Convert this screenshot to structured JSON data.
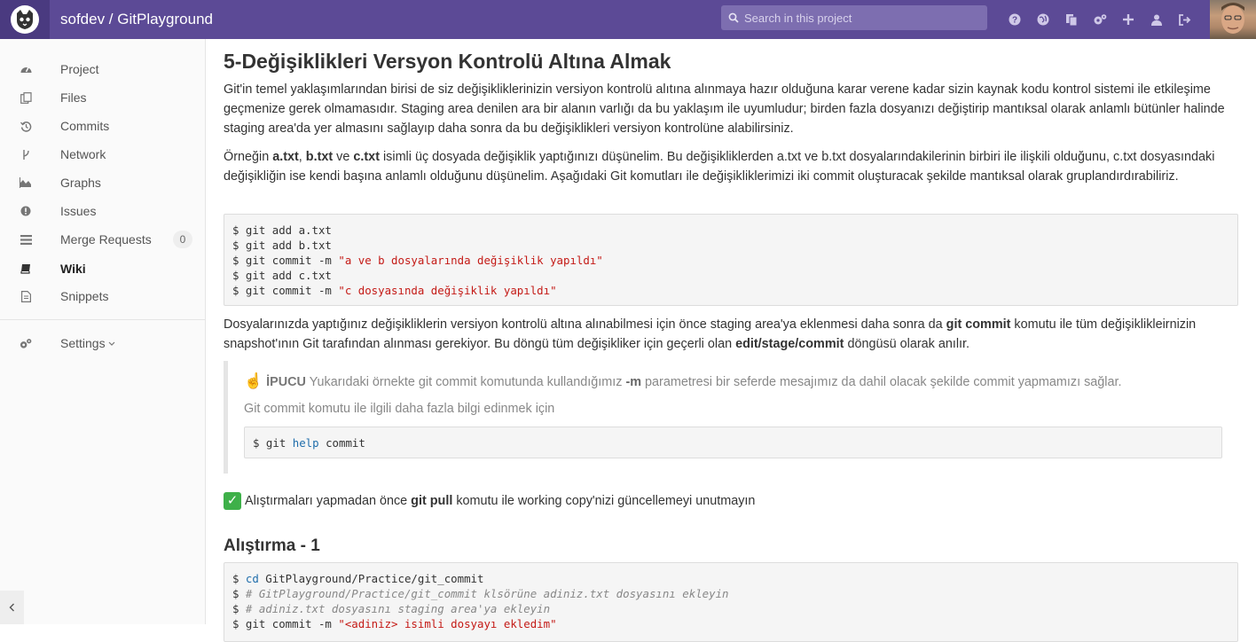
{
  "header": {
    "title": "sofdev / GitPlayground",
    "search_placeholder": "Search in this project",
    "icons": [
      "help-icon",
      "globe-icon",
      "copy-icon",
      "admin-icon",
      "plus-icon",
      "user-icon",
      "signout-icon"
    ]
  },
  "sidebar": {
    "items": [
      {
        "label": "Project",
        "icon": "dashboard-icon"
      },
      {
        "label": "Files",
        "icon": "files-icon"
      },
      {
        "label": "Commits",
        "icon": "history-icon"
      },
      {
        "label": "Network",
        "icon": "branch-icon"
      },
      {
        "label": "Graphs",
        "icon": "area-chart-icon"
      },
      {
        "label": "Issues",
        "icon": "exclamation-icon"
      },
      {
        "label": "Merge Requests",
        "icon": "list-icon",
        "badge": "0"
      },
      {
        "label": "Wiki",
        "icon": "book-icon",
        "active": true
      },
      {
        "label": "Snippets",
        "icon": "file-text-icon"
      }
    ],
    "settings_label": "Settings"
  },
  "main": {
    "heading": "5-Değişiklikleri Versyon Kontrolü Altına Almak",
    "p1": "Git'in temel yaklaşımlarından birisi de siz değişikliklerinizin versiyon kontrolü alıtına alınmaya hazır olduğuna karar verene kadar sizin kaynak kodu kontrol sistemi ile etkileşime geçmenize gerek olmamasıdır. Staging area denilen ara bir alanın varlığı da bu yaklaşım ile uyumludur; birden fazla dosyanızı değiştirip mantıksal olarak anlamlı bütünler halinde staging area'da yer almasını sağlayıp daha sonra da bu değişiklikleri versiyon kontrolüne alabilirsiniz.",
    "p2_parts": [
      "Örneğin ",
      "a.txt",
      ", ",
      "b.txt",
      " ve ",
      "c.txt",
      " isimli üç dosyada değişiklik yaptığınızı düşünelim. Bu değişikliklerden a.txt ve b.txt dosyalarındakilerinin birbiri ile ilişkili olduğunu, c.txt dosyasındaki değişikliğin ise kendi başına anlamlı olduğunu düşünelim. Aşağıdaki Git komutları ile değişikliklerimizi iki commit oluşturacak şekilde mantıksal olarak gruplandırdırabiliriz."
    ],
    "code1": {
      "lines": [
        {
          "cmd": "$ git add a.txt",
          "str": ""
        },
        {
          "cmd": "$ git add b.txt",
          "str": ""
        },
        {
          "cmd": "$ git commit -m ",
          "str": "\"a ve b dosyalarında değişiklik yapıldı\""
        },
        {
          "cmd": "$ git add c.txt",
          "str": ""
        },
        {
          "cmd": "$ git commit -m ",
          "str": "\"c dosyasında değişiklik yapıldı\""
        }
      ]
    },
    "p3_parts": [
      "Dosyalarınızda yaptığınız değişikliklerin versiyon kontrolü altına alınabilmesi için önce staging area'ya eklenmesi daha sonra da ",
      "git commit",
      " komutu ile tüm değişiklikleirnizin snapshot'ının Git tarafından alınması gerekiyor. Bu döngü tüm değişikliker için geçerli olan ",
      "edit/stage/commit",
      " döngüsü olarak anılır."
    ],
    "tip": {
      "emoji": "☝",
      "label": "İPUCU",
      "text_before": " Yukarıdaki örnekte git commit komutunda kullandığımız ",
      "param": "-m",
      "text_after": " parametresi bir seferde mesajımız da dahil olacak şekilde commit yapmamızı sağlar.",
      "more": "Git commit komutu ile ilgili daha fazla bilgi edinmek için",
      "code_prefix": "$ git ",
      "code_kw": "help",
      "code_suffix": " commit"
    },
    "reminder_parts": [
      "Alıştırmaları yapmadan önce ",
      "git pull",
      " komutu ile working copy'nizi güncellemeyi unutmayın"
    ],
    "check_glyph": "✓",
    "exercise_heading": "Alıştırma - 1",
    "code2": {
      "lines": [
        {
          "pre": "$ ",
          "kw": "cd",
          "rest": " GitPlayground/Practice/git_commit"
        },
        {
          "pre": "$ ",
          "cmt": "# GitPlayground/Practice/git_commit klsörüne adiniz.txt dosyasını ekleyin"
        },
        {
          "pre": "$ ",
          "cmt": "# adiniz.txt dosyasını staging area'ya ekleyin"
        },
        {
          "pre": "$ git commit -m ",
          "str": "\"<adiniz> isimli dosyayı ekledim\""
        }
      ]
    }
  }
}
